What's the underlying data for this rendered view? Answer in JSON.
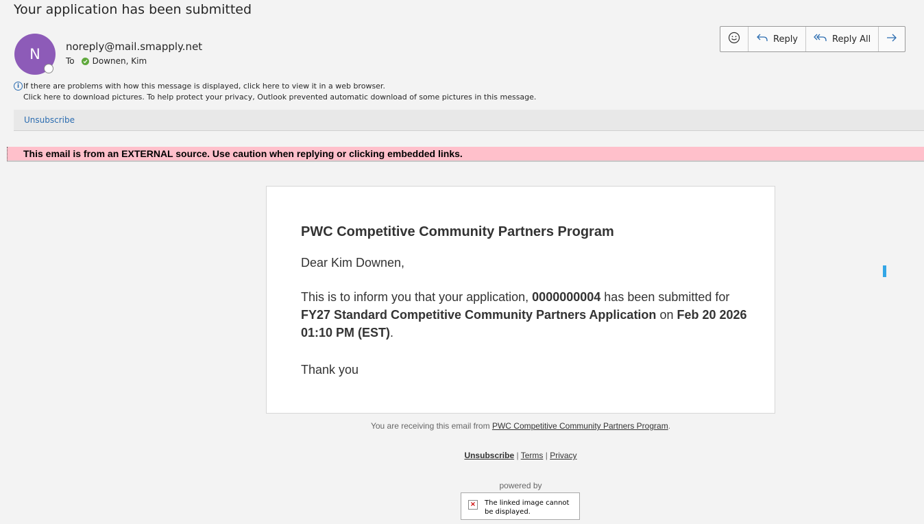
{
  "subject": "Your application has been submitted",
  "avatar_initial": "N",
  "sender": "noreply@mail.smapply.net",
  "to": {
    "label": "To",
    "recipient": "Downen, Kim"
  },
  "toolbar": {
    "emoji_icon": "smiley-icon",
    "reply_label": "Reply",
    "reply_all_label": "Reply All",
    "forward_icon": "arrow-right-icon"
  },
  "info": {
    "line1": "If there are problems with how this message is displayed, click here to view it in a web browser.",
    "line2": "Click here to download pictures. To help protect your privacy, Outlook prevented automatic download of some pictures in this message."
  },
  "unsubscribe_label": "Unsubscribe",
  "external_banner": "This email is from an EXTERNAL source. Use caution when replying or clicking embedded links.",
  "card": {
    "title": "PWC Competitive Community Partners Program",
    "greeting": "Dear Kim Downen,",
    "body_prefix": "This is to inform you that your application,",
    "application_number": "0000000004",
    "body_mid1": "has been submitted for",
    "program_name": "FY27 Standard Competitive Community Partners Application",
    "body_mid2": "on",
    "submitted_at": "Feb 20 2026 01:10 PM (EST)",
    "body_suffix": ".",
    "thanks": "Thank you"
  },
  "footer": {
    "receiving_prefix": "You are receiving this email from",
    "receiving_link": "PWC Competitive Community Partners Program",
    "receiving_suffix": ".",
    "unsubscribe": "Unsubscribe",
    "sep": "|",
    "terms": "Terms",
    "privacy": "Privacy",
    "powered_by": "powered by",
    "broken_image_text": "The linked image cannot be displayed."
  },
  "colors": {
    "avatar": "#8d5bb8",
    "banner": "#ffc0cb",
    "link": "#2b6cb0",
    "accent_indicator": "#33a6e6"
  }
}
